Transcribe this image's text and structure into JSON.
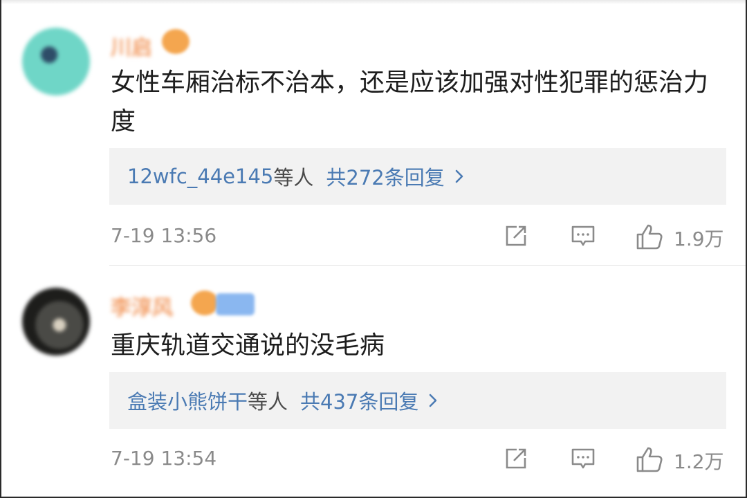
{
  "comments": [
    {
      "username": "川启",
      "text": "女性车厢治标不治本，还是应该加强对性犯罪的惩治力度",
      "reply_users": "12wfc_44e145",
      "reply_suffix": "等人",
      "reply_count": "共272条回复",
      "time": "7-19 13:56",
      "likes": "1.9万"
    },
    {
      "username": "李淳风",
      "text": "重庆轨道交通说的没毛病",
      "reply_users": "盒装小熊饼干",
      "reply_suffix": "等人",
      "reply_count": "共437条回复",
      "time": "7-19 13:54",
      "likes": "1.2万"
    }
  ],
  "icons": {
    "share": "share-icon",
    "comment": "comment-icon",
    "like": "thumbs-up-icon",
    "chevron": "chevron-right-icon",
    "vip": "crown-icon"
  },
  "colors": {
    "link": "#4a7ab3",
    "username": "#f3a06a",
    "meta": "#8a8a8a",
    "reply_bg": "#f2f2f2"
  }
}
